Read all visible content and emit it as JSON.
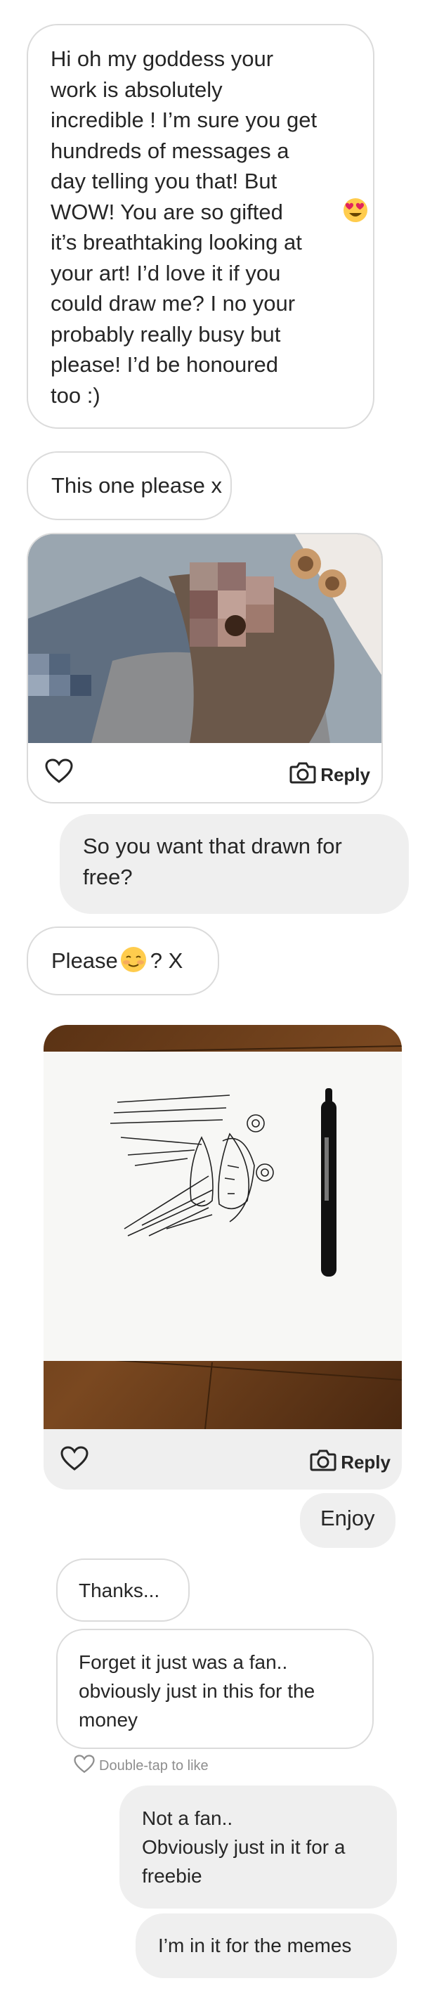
{
  "messages": {
    "m1": "Hi oh my goddess your\nwork is absolutely\nincredible ! I’m sure you get\nhundreds of messages a\nday telling you that! But\nWOW! You are so gifted",
    "m1_cont": "it’s breathtaking looking at\nyour art! I’d love it if you\ncould draw me? I no your\nprobably really busy but\nplease! I’d be honoured\ntoo :)",
    "m2": "This one please x",
    "m3": "So you want that drawn for\nfree?",
    "m4_a": "Please",
    "m4_b": "? X",
    "m5": "Enjoy",
    "m6": "Thanks...",
    "m7": "Forget it just was a fan..\nobviously just in this for the\nmoney",
    "m8": "Not a fan..\nObviously just in it for a\nfreebie",
    "m9": "I’m in it for the memes"
  },
  "photo1": {
    "reply_label": "Reply",
    "heart_icon": "heart-outline-icon",
    "camera_icon": "camera-icon"
  },
  "photo2": {
    "reply_label": "Reply",
    "heart_icon": "heart-outline-icon",
    "camera_icon": "camera-icon"
  },
  "double_tap_label": "Double-tap to like",
  "colors": {
    "received_border": "#dbdbdb",
    "sent_bg": "#efefef",
    "text": "#262626",
    "muted": "#8e8e8e"
  }
}
